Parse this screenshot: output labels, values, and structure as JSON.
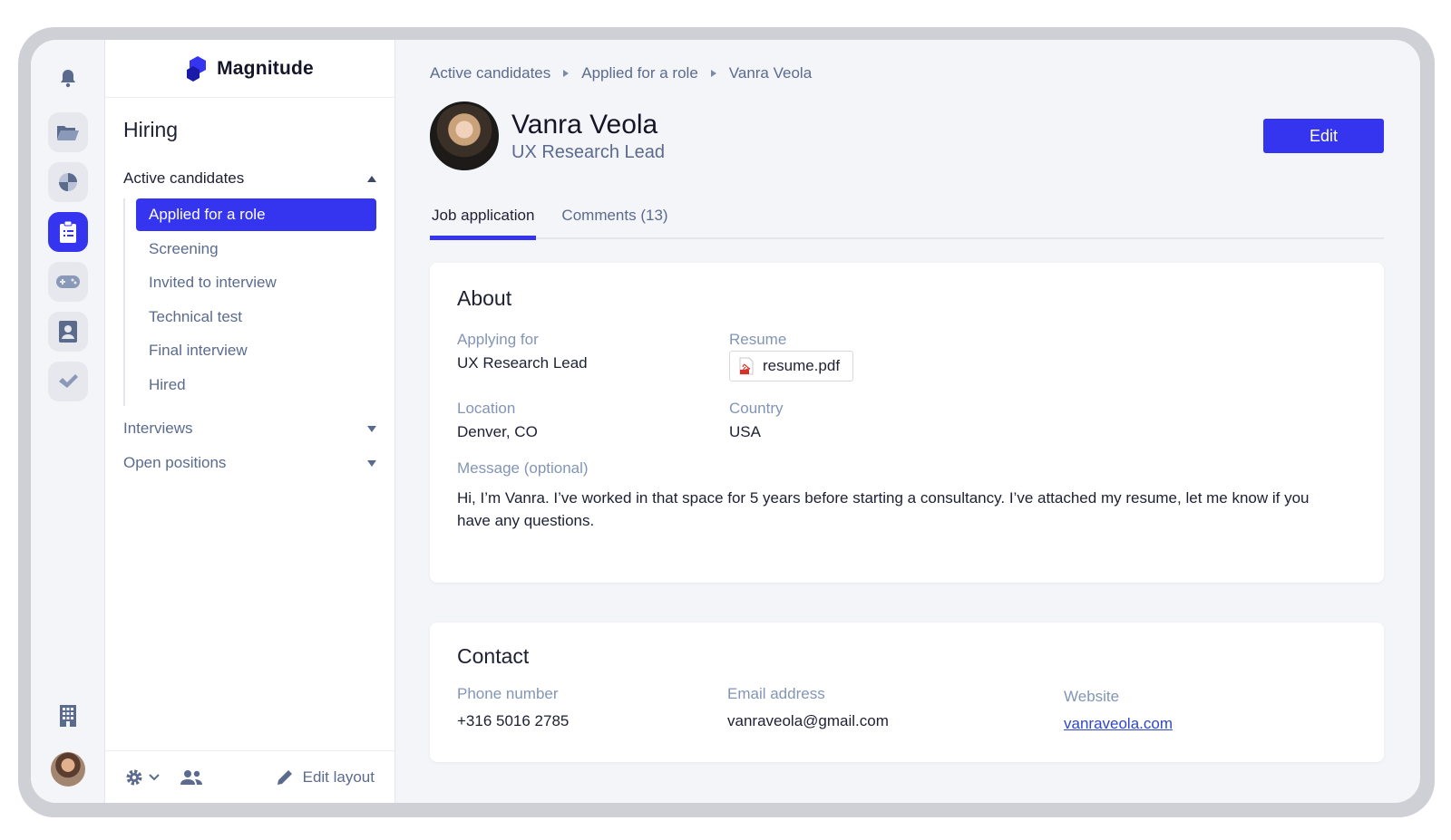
{
  "brand": {
    "name": "Magnitude",
    "accent": "#3535ef"
  },
  "rail": {
    "icons": [
      "bell-icon",
      "folder-icon",
      "pie-chart-icon",
      "clipboard-icon",
      "gamepad-icon",
      "contact-card-icon",
      "checkmark-icon",
      "building-icon"
    ],
    "active": "clipboard-icon"
  },
  "nav": {
    "section_title": "Hiring",
    "active_candidates": {
      "label": "Active candidates",
      "items": [
        "Applied for a role",
        "Screening",
        "Invited to interview",
        "Technical test",
        "Final interview",
        "Hired"
      ],
      "selected": "Applied for a role"
    },
    "interviews_label": "Interviews",
    "open_positions_label": "Open positions",
    "footer": {
      "edit_layout_label": "Edit layout"
    }
  },
  "breadcrumb": [
    "Active candidates",
    "Applied for a role",
    "Vanra Veola"
  ],
  "profile": {
    "name": "Vanra Veola",
    "role": "UX Research Lead"
  },
  "edit_button_label": "Edit",
  "tabs": [
    {
      "label": "Job application",
      "active": true
    },
    {
      "label": "Comments (13)",
      "active": false
    }
  ],
  "about": {
    "title": "About",
    "applying_for": {
      "label": "Applying for",
      "value": "UX Research Lead"
    },
    "resume": {
      "label": "Resume",
      "file": "resume.pdf"
    },
    "location": {
      "label": "Location",
      "value": "Denver, CO"
    },
    "country": {
      "label": "Country",
      "value": "USA"
    },
    "message": {
      "label": "Message (optional)",
      "value": "Hi, I’m Vanra. I’ve worked in that space for 5 years before starting a consultancy. I’ve attached my resume, let me know if you have any questions."
    }
  },
  "contact": {
    "title": "Contact",
    "phone": {
      "label": "Phone number",
      "value": "+316 5016 2785"
    },
    "email": {
      "label": "Email address",
      "value": "vanraveola@gmail.com"
    },
    "website": {
      "label": "Website",
      "value": "vanraveola.com"
    }
  }
}
